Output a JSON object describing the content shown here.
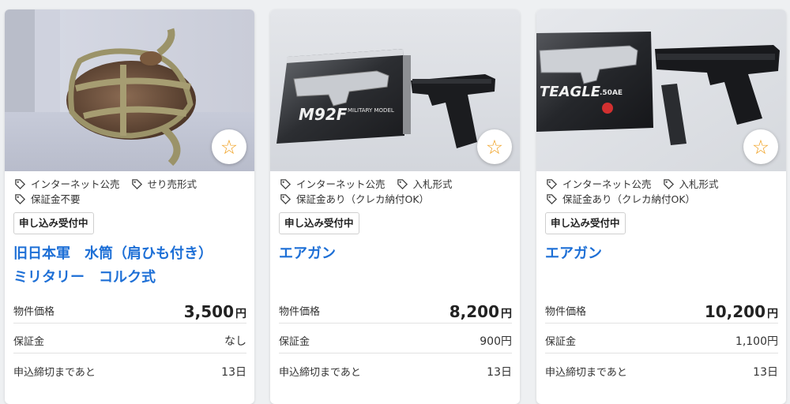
{
  "cards": [
    {
      "tags": [
        "インターネット公売",
        "せり売形式",
        "保証金不要"
      ],
      "status": "申し込み受付中",
      "title_line1": "旧日本軍　水筒（肩ひも付き）",
      "title_line2": "ミリタリー　コルク式",
      "price_label": "物件価格",
      "price": "3,500",
      "price_unit": "円",
      "deposit_label": "保証金",
      "deposit": "なし",
      "deadline_label": "申込締切まであと",
      "deadline": "13日"
    },
    {
      "tags": [
        "インターネット公売",
        "入札形式",
        "保証金あり（クレカ納付OK）"
      ],
      "status": "申し込み受付中",
      "title_line1": "エアガン",
      "price_label": "物件価格",
      "price": "8,200",
      "price_unit": "円",
      "deposit_label": "保証金",
      "deposit": "900円",
      "deadline_label": "申込締切まであと",
      "deadline": "13日",
      "box_text_main": "M92F",
      "box_text_sub": "MILITARY MODEL"
    },
    {
      "tags": [
        "インターネット公売",
        "入札形式",
        "保証金あり（クレカ納付OK）"
      ],
      "status": "申し込み受付中",
      "title_line1": "エアガン",
      "price_label": "物件価格",
      "price": "10,200",
      "price_unit": "円",
      "deposit_label": "保証金",
      "deposit": "1,100円",
      "deadline_label": "申込締切まであと",
      "deadline": "13日",
      "box_text_main": "TEAGLE",
      "box_text_sub": ".50AE"
    }
  ],
  "icons": {
    "tag": "tag-icon",
    "favorite": "star-outline-icon"
  },
  "colors": {
    "title": "#1d6fd6",
    "star": "#f0a020"
  }
}
